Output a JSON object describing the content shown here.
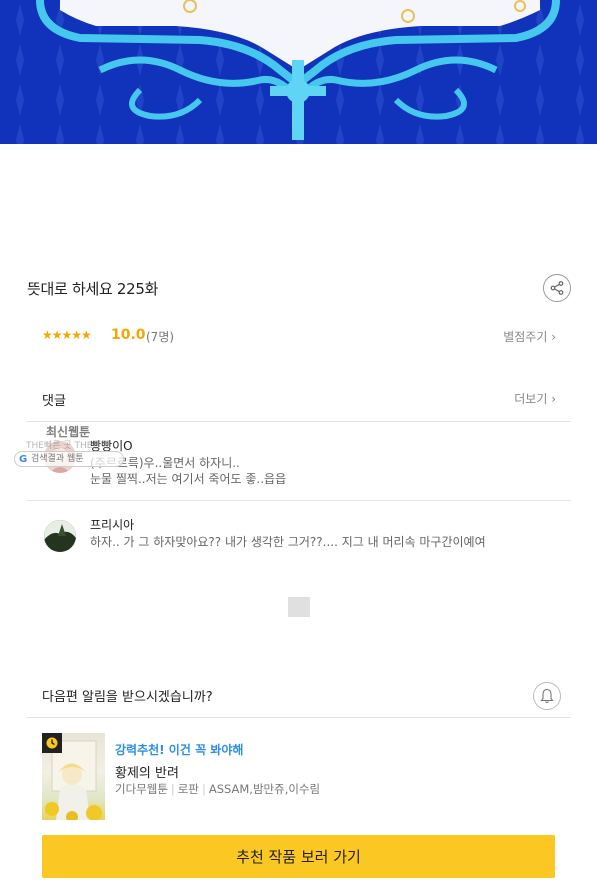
{
  "episode": {
    "title": "뜻대로 하세요 225화"
  },
  "rating": {
    "stars": "★★★★★",
    "score": "10.0",
    "count": "(7명)",
    "rate_link": "별점주기 ›"
  },
  "comments": {
    "label": "댓글",
    "more": "더보기 ›",
    "items": [
      {
        "name": "빵빵이O",
        "text_line1": "(주르르륵)우..울면서 하자니..",
        "text_line2": "눈물 찔찍..저는 여기서 죽어도 좋..읍읍"
      },
      {
        "name": "프리시아",
        "text_line1": "하자.. 가 그 하자맞아요?? 내가 생각한 그거??.... 지그 내 머리속 마구간이예여",
        "text_line2": ""
      }
    ]
  },
  "overlay": {
    "title": "최신웹툰",
    "sub": "THE빠른 곳 THE편해",
    "pill_g": "G",
    "pill_text": "검색결과   웹툰"
  },
  "notify": {
    "text": "다음편 알림을 받으시겠습니까?"
  },
  "recommend": {
    "tag": "강력추천! 이건 꼭 봐야해",
    "title": "황제의 반려",
    "meta": [
      "기다무웹툰",
      "로판",
      "ASSAM,밤만쥬,이수림"
    ],
    "cta": "추천 작품 보러 가기"
  },
  "colors": {
    "banner": "#1030b8",
    "ornament": "#46c8ee",
    "accent": "#f6a600",
    "cta": "#fbc823",
    "tag": "#2e8ee6"
  }
}
